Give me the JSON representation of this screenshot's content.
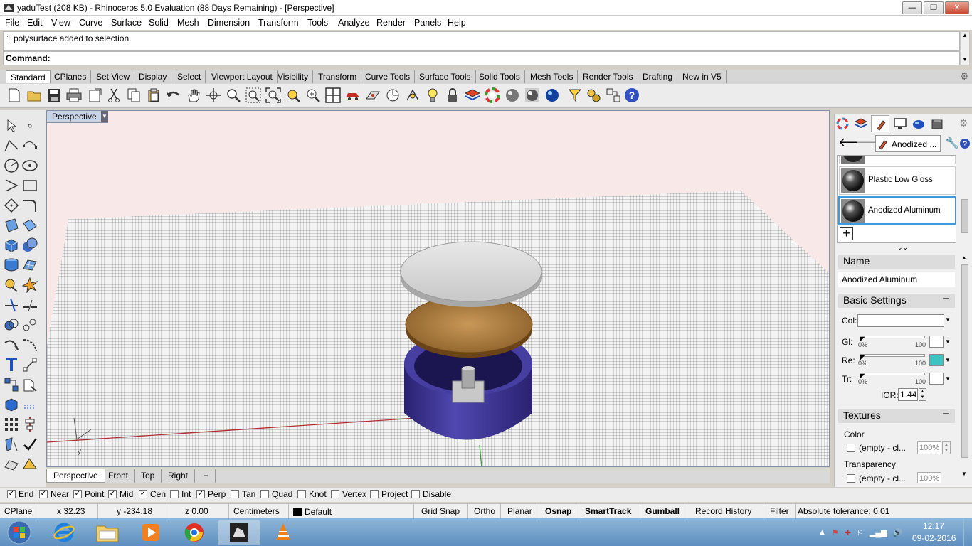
{
  "window": {
    "title": "yaduTest (208 KB) - Rhinoceros 5.0 Evaluation (88 Days Remaining) - [Perspective]",
    "controls": [
      "—",
      "❐",
      "✕"
    ]
  },
  "menu": [
    "File",
    "Edit",
    "View",
    "Curve",
    "Surface",
    "Solid",
    "Mesh",
    "Dimension",
    "Transform",
    "Tools",
    "Analyze",
    "Render",
    "Panels",
    "Help"
  ],
  "command": {
    "history": "1 polysurface added to selection.",
    "prompt": "Command:"
  },
  "toolbar_tabs": [
    "Standard",
    "CPlanes",
    "Set View",
    "Display",
    "Select",
    "Viewport Layout",
    "Visibility",
    "Transform",
    "Curve Tools",
    "Surface Tools",
    "Solid Tools",
    "Mesh Tools",
    "Render Tools",
    "Drafting",
    "New in V5"
  ],
  "viewport": {
    "name": "Perspective",
    "tabs": [
      "Perspective",
      "Front",
      "Top",
      "Right"
    ],
    "add_tab": "+"
  },
  "materials_panel": {
    "current": "Anodized ...",
    "items": [
      "Plastic Low Gloss",
      "Anodized Aluminum"
    ],
    "name_label": "Name",
    "name_value": "Anodized Aluminum",
    "basic_settings": "Basic Settings",
    "color_label": "Col:",
    "sliders": [
      {
        "label": "Gl:",
        "min": "0%",
        "max": "100",
        "value": 0.0,
        "swatch": "#ffffff"
      },
      {
        "label": "Re:",
        "min": "0%",
        "max": "100",
        "value": 0.0,
        "swatch": "#3cc3c3"
      },
      {
        "label": "Tr:",
        "min": "0%",
        "max": "100",
        "value": 0.0,
        "swatch": "#ffffff"
      }
    ],
    "ior_label": "IOR:",
    "ior_value": "1.44",
    "textures": "Textures",
    "tex_color": "Color",
    "tex_color_slot": "(empty - cl...",
    "tex_color_pct": "100%",
    "tex_transparency": "Transparency",
    "tex_transp_slot": "(empty - cl...",
    "tex_transp_pct": "100%"
  },
  "osnaps": [
    {
      "label": "End",
      "checked": true
    },
    {
      "label": "Near",
      "checked": true
    },
    {
      "label": "Point",
      "checked": true
    },
    {
      "label": "Mid",
      "checked": true
    },
    {
      "label": "Cen",
      "checked": true
    },
    {
      "label": "Int",
      "checked": false
    },
    {
      "label": "Perp",
      "checked": true
    },
    {
      "label": "Tan",
      "checked": false
    },
    {
      "label": "Quad",
      "checked": false
    },
    {
      "label": "Knot",
      "checked": false
    },
    {
      "label": "Vertex",
      "checked": false
    },
    {
      "label": "Project",
      "checked": false
    },
    {
      "label": "Disable",
      "checked": false
    }
  ],
  "status": {
    "cplane": "CPlane",
    "x": "x 32.23",
    "y": "y -234.18",
    "z": "z 0.00",
    "units": "Centimeters",
    "layer": "Default",
    "grid_snap": "Grid Snap",
    "ortho": "Ortho",
    "planar": "Planar",
    "osnap": "Osnap",
    "smarttrack": "SmartTrack",
    "gumball": "Gumball",
    "record_history": "Record History",
    "filter": "Filter",
    "tolerance": "Absolute tolerance: 0.01"
  },
  "clock": {
    "time": "12:17",
    "date": "09-02-2016"
  },
  "colors": {
    "viewport_bg": "#f8e8e8",
    "grid": "#8c8c8c",
    "base_purple": "#3b3190",
    "wood": "#a8793e",
    "lid": "#d4d4d4",
    "re_swatch": "#3cc3c3"
  }
}
